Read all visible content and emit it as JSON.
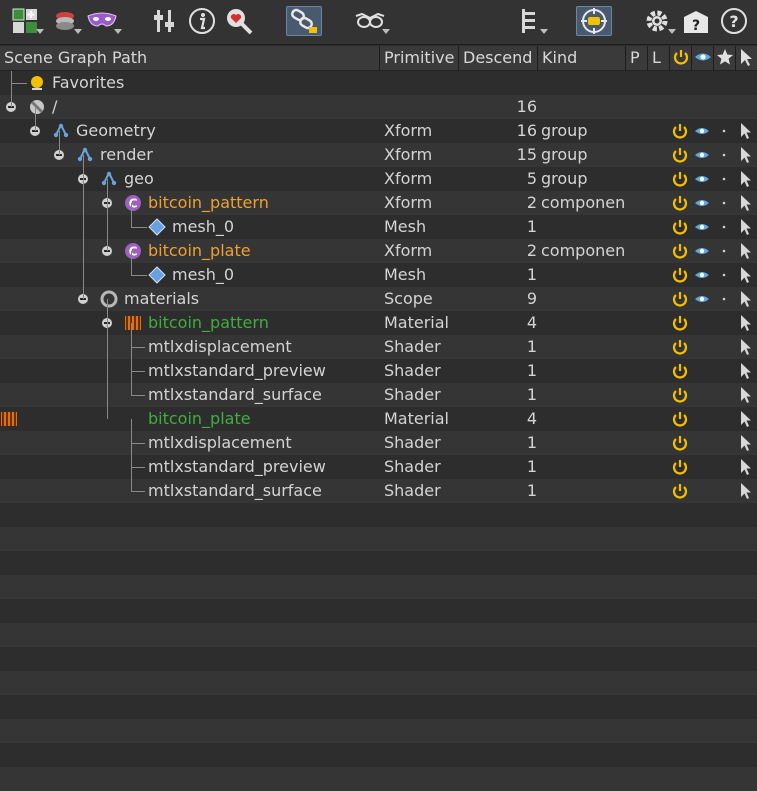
{
  "toolbar": {
    "icons": [
      "add-prim-icon",
      "layers-icon",
      "mask-icon",
      "sliders-icon",
      "info-icon",
      "search-heart-icon",
      "link-selection-icon",
      "glasses-icon",
      "hierarchy-icon",
      "target-icon",
      "gear-icon",
      "help-box-icon",
      "help-circle-icon"
    ]
  },
  "header": {
    "path": "Scene Graph Path",
    "primitive": "Primitive",
    "descend": "Descend",
    "kind": "Kind",
    "p": "P",
    "l": "L"
  },
  "rows": [
    {
      "name": "Favorites",
      "primitive": "",
      "descend": "",
      "kind": "",
      "color": "#d4d4d4",
      "icon": "favorites-icon",
      "flags": []
    },
    {
      "name": "/",
      "primitive": "",
      "descend": "16",
      "kind": "",
      "color": "#d4d4d4",
      "icon": "root-icon",
      "flags": []
    },
    {
      "name": "Geometry",
      "primitive": "Xform",
      "descend": "16",
      "kind": "group",
      "color": "#d4d4d4",
      "icon": "xform-icon",
      "flags": [
        "active",
        "visible",
        "dot",
        "select"
      ]
    },
    {
      "name": "render",
      "primitive": "Xform",
      "descend": "15",
      "kind": "group",
      "color": "#d4d4d4",
      "icon": "xform-icon",
      "flags": [
        "active",
        "visible",
        "dot",
        "select"
      ]
    },
    {
      "name": "geo",
      "primitive": "Xform",
      "descend": "5",
      "kind": "group",
      "color": "#d4d4d4",
      "icon": "xform-icon",
      "flags": [
        "active",
        "visible",
        "dot",
        "select"
      ]
    },
    {
      "name": "bitcoin_pattern",
      "primitive": "Xform",
      "descend": "2",
      "kind": "componen",
      "color": "#f0a030",
      "icon": "component-icon",
      "flags": [
        "active",
        "visible",
        "dot",
        "select"
      ]
    },
    {
      "name": "mesh_0",
      "primitive": "Mesh",
      "descend": "1",
      "kind": "",
      "color": "#d4d4d4",
      "icon": "mesh-icon",
      "flags": [
        "active",
        "visible",
        "dot",
        "select"
      ]
    },
    {
      "name": "bitcoin_plate",
      "primitive": "Xform",
      "descend": "2",
      "kind": "componen",
      "color": "#f0a030",
      "icon": "component-icon",
      "flags": [
        "active",
        "visible",
        "dot",
        "select"
      ]
    },
    {
      "name": "mesh_0",
      "primitive": "Mesh",
      "descend": "1",
      "kind": "",
      "color": "#d4d4d4",
      "icon": "mesh-icon",
      "flags": [
        "active",
        "visible",
        "dot",
        "select"
      ]
    },
    {
      "name": "materials",
      "primitive": "Scope",
      "descend": "9",
      "kind": "",
      "color": "#d4d4d4",
      "icon": "scope-icon",
      "flags": [
        "active",
        "visible",
        "dot",
        "select"
      ]
    },
    {
      "name": "bitcoin_pattern",
      "primitive": "Material",
      "descend": "4",
      "kind": "",
      "color": "#3fae3f",
      "icon": "material-icon",
      "flags": [
        "active",
        "select"
      ]
    },
    {
      "name": "mtlxdisplacement",
      "primitive": "Shader",
      "descend": "1",
      "kind": "",
      "color": "#d4d4d4",
      "icon": "",
      "flags": [
        "active",
        "select"
      ]
    },
    {
      "name": "mtlxstandard_preview",
      "primitive": "Shader",
      "descend": "1",
      "kind": "",
      "color": "#d4d4d4",
      "icon": "",
      "flags": [
        "active",
        "select"
      ]
    },
    {
      "name": "mtlxstandard_surface",
      "primitive": "Shader",
      "descend": "1",
      "kind": "",
      "color": "#d4d4d4",
      "icon": "",
      "flags": [
        "active",
        "select"
      ]
    },
    {
      "name": "bitcoin_plate",
      "primitive": "Material",
      "descend": "4",
      "kind": "",
      "color": "#3fae3f",
      "icon": "material-icon",
      "flags": [
        "active",
        "select"
      ]
    },
    {
      "name": "mtlxdisplacement",
      "primitive": "Shader",
      "descend": "1",
      "kind": "",
      "color": "#d4d4d4",
      "icon": "",
      "flags": [
        "active",
        "select"
      ]
    },
    {
      "name": "mtlxstandard_preview",
      "primitive": "Shader",
      "descend": "1",
      "kind": "",
      "color": "#d4d4d4",
      "icon": "",
      "flags": [
        "active",
        "select"
      ]
    },
    {
      "name": "mtlxstandard_surface",
      "primitive": "Shader",
      "descend": "1",
      "kind": "",
      "color": "#d4d4d4",
      "icon": "",
      "flags": [
        "active",
        "select"
      ]
    }
  ],
  "colors": {
    "accent_yellow": "#f2c200",
    "visible_blue": "#5aa8e6",
    "component_purple": "#a060c0",
    "material_orange": "#e07010",
    "mesh_blue": "#6aa0e0"
  }
}
